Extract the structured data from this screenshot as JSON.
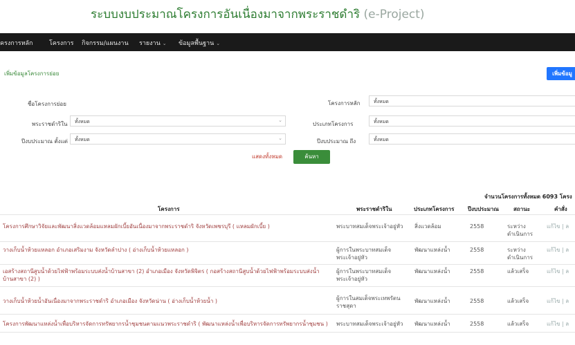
{
  "app": {
    "title": "ระบบงบประมาณโครงการอันเนื่องมาจากพระราชดำริ",
    "subtitle": "(e-Project)"
  },
  "nav": [
    {
      "label": "ครงการหลัก",
      "caret": false
    },
    {
      "label": "โครงการ",
      "caret": false
    },
    {
      "label": "กิจกรรม/แผนงาน",
      "caret": false
    },
    {
      "label": "รายงาน",
      "caret": true
    },
    {
      "label": "ข้อมูลพื้นฐาน",
      "caret": true
    }
  ],
  "breadcrumb": "เพิ่มข้อมูลโครงการย่อย",
  "add_button": "เพิ่มข้อมู",
  "filters": {
    "sub_project_label": "ชื่อโครงการย่อย",
    "main_project_label": "โครงการหลัก",
    "main_project_value": "ทั้งหมด",
    "royal_label": "พระราชดำริใน",
    "royal_value": "ทั้งหมด",
    "type_label": "ประเภทโครงการ",
    "type_value": "ทั้งหมด",
    "year_from_label": "ปีงบประมาณ ตั้งแต่",
    "year_from_value": "ทั้งหมด",
    "year_to_label": "ปีงบประมาณ ถึง",
    "year_to_value": "ทั้งหมด"
  },
  "buttons": {
    "show_all": "แสดงทั้งหมด",
    "search": "ค้นหา"
  },
  "total": "จำนวนโครงการทั้งหมด 6093 โครง",
  "table": {
    "headers": [
      "โครงการ",
      "พระราชดำริใน",
      "ประเภทโครงการ",
      "ปีงบประมาณ",
      "สถานะ",
      "คำสั่ง"
    ],
    "rows": [
      {
        "name": "โครงการศึกษาวิจัยและพัฒนาสิ่งแวดล้อมแหลมผักเบี้ยอันเนื่องมาจากพระราชดำริ จังหวัดเพชรบุรี ( แหลมผักเบี้ย )",
        "royal": "พระบาทสมเด็จพระเจ้าอยู่หัว",
        "type": "สิ่งแวดล้อม",
        "year": "2558",
        "status": "ระหว่างดำเนินการ",
        "actions": "แก้ไข | ล"
      },
      {
        "name": "วางเก็บน้ำห้วยแหลอก อำเภอเสริมงาม จังหวัดลำปาง ( อ่างเก็บน้ำห้วยแหลอก )",
        "royal": "ผู้การในพระบาทสมเด็จพระเจ้าอยู่หัว",
        "type": "พัฒนาแหล่งน้ำ",
        "year": "2558",
        "status": "ระหว่างดำเนินการ",
        "actions": "แก้ไข | ล"
      },
      {
        "name": "เอสร้างสถานีสูบน้ำด้วยไฟฟ้าพร้อมระบบส่งน้ำบ้านสาขา (2) อำเภอเมือง จังหวัดพิจิตร ( กอสร้างสถานีสูบน้ำด้วยไฟฟ้าพร้อมระบบส่งน้ำบ้านสาขา (2) )",
        "royal": "ผู้การในพระบาทสมเด็จพระเจ้าอยู่หัว",
        "type": "พัฒนาแหล่งน้ำ",
        "year": "2558",
        "status": "แล้วเสร็จ",
        "actions": "แก้ไข | ล"
      },
      {
        "name": "วางเก็บน้ำห้วยน้ำอันเนื่องมาจากพระราชดำริ อำเภอเมือง จังหวัดน่าน ( อ่างเก็บน้ำห้วยน้ำ )",
        "royal": "ผู้การในสมเด็จพระเทพรัตนราชสุดา",
        "type": "พัฒนาแหล่งน้ำ",
        "year": "2558",
        "status": "แล้วเสร็จ",
        "actions": "แก้ไข | ล"
      },
      {
        "name": "โครงการพัฒนาแหล่งน้ำเพื่อบริหารจัดการทรัพยากรน้ำชุมชนตามแนวพระราชดำริ ( พัฒนาแหล่งน้ำเพื่อบริหารจัดการทรัพยากรน้ำชุมชน )",
        "royal": "พระบาทสมเด็จพระเจ้าอยู่หัว",
        "type": "พัฒนาแหล่งน้ำ",
        "year": "2558",
        "status": "แล้วเสร็จ",
        "actions": "แก้ไข | ล"
      }
    ]
  }
}
